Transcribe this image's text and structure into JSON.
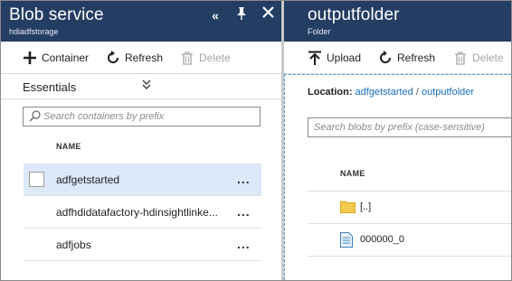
{
  "left_blade": {
    "title": "Blob service",
    "subtitle": "hdiadfstorage",
    "toolbar": {
      "container_label": "Container",
      "refresh_label": "Refresh",
      "delete_label": "Delete"
    },
    "essentials_label": "Essentials",
    "search": {
      "placeholder": "Search containers by prefix"
    },
    "column_header": "NAME",
    "containers": [
      {
        "name": "adfgetstarted",
        "selected": true
      },
      {
        "name": "adfhdidatafactory-hdinsightlinke...",
        "selected": false
      },
      {
        "name": "adfjobs",
        "selected": false
      }
    ],
    "more_glyph": "..."
  },
  "right_blade": {
    "title": "outputfolder",
    "subtitle": "Folder",
    "toolbar": {
      "upload_label": "Upload",
      "refresh_label": "Refresh",
      "delete_label": "Delete"
    },
    "location": {
      "label": "Location:",
      "path_1": "adfgetstarted",
      "separator": "/",
      "path_2": "outputfolder"
    },
    "search": {
      "placeholder": "Search blobs by prefix (case-sensitive)"
    },
    "column_header": "NAME",
    "items": [
      {
        "name": "[..]",
        "icon": "folder-icon"
      },
      {
        "name": "000000_0",
        "icon": "file-icon"
      }
    ]
  },
  "colors": {
    "header_bg": "#233d63",
    "selection_bg": "#dbe9f8",
    "link": "#1a6fb8"
  }
}
